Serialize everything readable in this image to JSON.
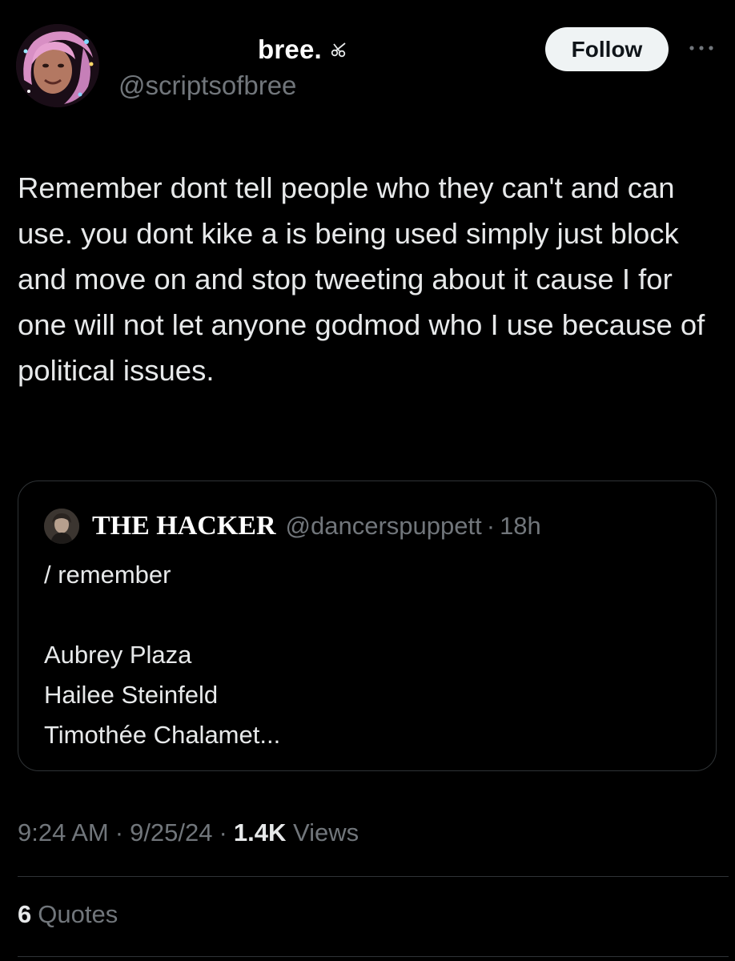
{
  "author": {
    "display_name": "bree.",
    "name_emoji": "scissors-icon",
    "handle": "@scriptsofbree",
    "avatar": "profile-photo"
  },
  "follow_button": {
    "label": "Follow"
  },
  "more_menu": {
    "icon": "more-icon"
  },
  "tweet": {
    "text": "Remember dont tell people who they can't and can use. you dont kike a is being used simply just block and move on and stop tweeting about it cause I for one will not let anyone godmod who I use because of political issues."
  },
  "quoted_tweet": {
    "author_name": "THE HACKER",
    "author_handle": "@dancerspuppett",
    "separator": "·",
    "time": "18h",
    "lines": [
      "/ remember",
      "",
      "Aubrey Plaza",
      "Hailee Steinfeld",
      "Timothée Chalamet..."
    ]
  },
  "meta": {
    "time": "9:24 AM",
    "separator": "·",
    "date": "9/25/24",
    "views_count": "1.4K",
    "views_label": "Views"
  },
  "stats": {
    "quotes_count": "6",
    "quotes_label": "Quotes"
  },
  "colors": {
    "background": "#000000",
    "text_primary": "#e7e9ea",
    "text_secondary": "#71767b",
    "border": "#2f3336",
    "follow_bg": "#eff3f4"
  }
}
